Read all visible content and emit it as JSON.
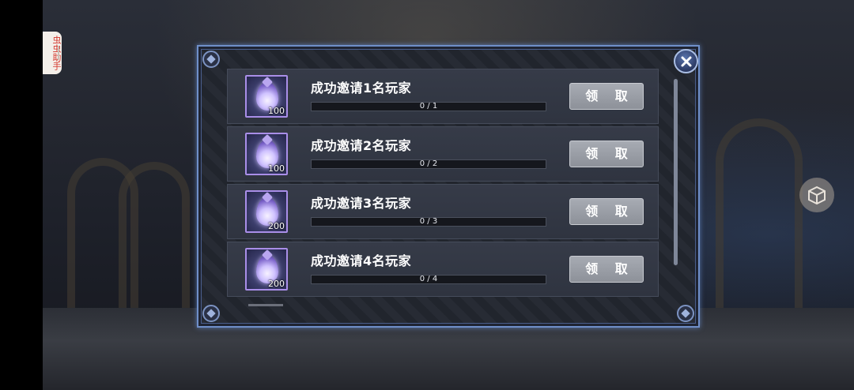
{
  "side_helper": {
    "label": "虫虫助手"
  },
  "task_panel": {
    "rows": [
      {
        "title": "成功邀请1名玩家",
        "reward_qty": "100",
        "progress_text": "0 / 1",
        "progress_fraction": 0,
        "button_label": "领 取"
      },
      {
        "title": "成功邀请2名玩家",
        "reward_qty": "100",
        "progress_text": "0 / 2",
        "progress_fraction": 0,
        "button_label": "领 取"
      },
      {
        "title": "成功邀请3名玩家",
        "reward_qty": "200",
        "progress_text": "0 / 3",
        "progress_fraction": 0,
        "button_label": "领 取"
      },
      {
        "title": "成功邀请4名玩家",
        "reward_qty": "200",
        "progress_text": "0 / 4",
        "progress_fraction": 0,
        "button_label": "领 取"
      }
    ]
  },
  "icons": {
    "close": "close-icon",
    "reward": "crystal-gem-icon",
    "side": "cube-icon"
  },
  "colors": {
    "panel_border": "#6f8fc9",
    "button_gray": "#9a9ea6",
    "item_border": "#a98ee8"
  }
}
